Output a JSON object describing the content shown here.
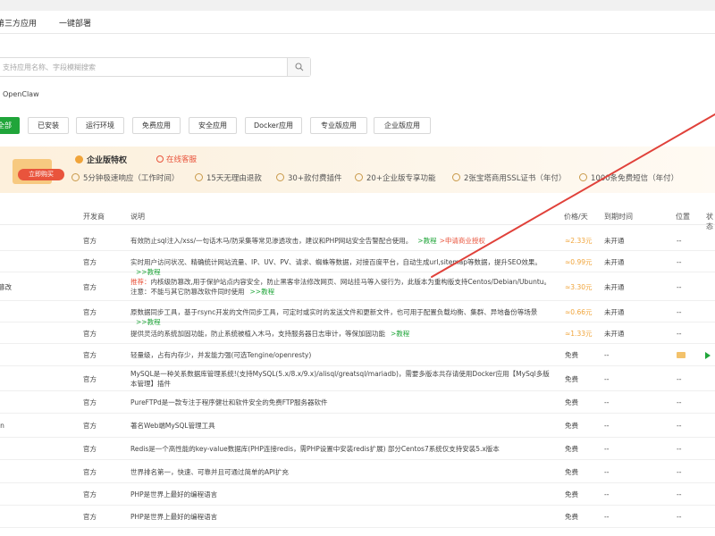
{
  "tabs": [
    "第三方应用",
    "一键部署"
  ],
  "search": {
    "placeholder": "支持应用名称、字段模糊搜索"
  },
  "recent": "OpenClaw",
  "categories": [
    "全部",
    "已安装",
    "运行环境",
    "免费应用",
    "安全应用",
    "Docker应用",
    "专业版应用",
    "企业版应用"
  ],
  "banner": {
    "badge": "立即购买",
    "title": "企业版特权",
    "service": "在线客服",
    "perks": [
      "5分钟极速响应（工作时间）",
      "15天无理由退款",
      "30+款付费插件",
      "20+企业版专享功能",
      "2张宝塔商用SSL证书（年付）",
      "1000条免费短信（年付）"
    ]
  },
  "table": {
    "headers": [
      "开发商",
      "说明",
      "价格/天",
      "到期时间",
      "位置",
      "状态"
    ],
    "rows": [
      {
        "name": "",
        "dev": "官方",
        "desc": "有效防止sql注入/xss/一句话木马/防采集等常见渗透攻击，建议和PHP网站安全告警配合使用。",
        "link1": ">教程",
        "link2": ">申请商业授权",
        "price": "≈2.33元",
        "expire": "未开通",
        "pos": "--",
        "status": ""
      },
      {
        "name": "",
        "dev": "官方",
        "desc": "实时用户访问状况、精确统计网站流量、IP、UV、PV、请求、蜘蛛等数据，对接百度平台，自动生成url,sitemap等数据，提升SEO效果。",
        "link1": ">>教程",
        "link2": "",
        "price": "≈0.99元",
        "expire": "未开通",
        "pos": "--",
        "status": ""
      },
      {
        "name": "篡改",
        "dev": "官方",
        "warn": "推荐：",
        "desc": "内核级防篡改,用于保护站点内容安全，防止黑客非法修改网页、网站挂马等入侵行为，此版本为重构版支持Centos/Debian/Ubuntu。注意：不能与其它防篡改软件同时使用",
        "link1": ">>教程",
        "link2": "",
        "price": "≈3.30元",
        "expire": "未开通",
        "pos": "--",
        "status": ""
      },
      {
        "name": "",
        "dev": "官方",
        "desc": "原数据同步工具，基于rsync开发的文件同步工具，可定时或实时的发送文件和更新文件，也可用于配置负载均衡、集群、异地备份等场景",
        "link1": ">>教程",
        "link2": "",
        "price": "≈0.66元",
        "expire": "未开通",
        "pos": "--",
        "status": ""
      },
      {
        "name": "",
        "dev": "官方",
        "desc": "提供灵活的系统加固功能，防止系统被植入木马，支持服务器日志审计，等保加固功能",
        "link1": ">教程",
        "link2": "",
        "price": "≈1.33元",
        "expire": "未开通",
        "pos": "--",
        "status": ""
      },
      {
        "name": "",
        "dev": "官方",
        "desc": "轻量级，占有内存少，并发能力强(可选Tengine/openresty)",
        "link1": "",
        "link2": "",
        "price": "免费",
        "expire": "--",
        "pos": "folder",
        "status": "play"
      },
      {
        "name": "",
        "dev": "官方",
        "desc": "MySQL是一种关系数据库管理系统!(支持MySQL(5.x/8.x/9.x)/alisql/greatsql/mariadb)，需要多版本共存请使用Docker应用【MySql多版本管理】插件",
        "link1": "",
        "link2": "",
        "price": "免费",
        "expire": "--",
        "pos": "--",
        "status": ""
      },
      {
        "name": "",
        "dev": "官方",
        "desc": "PureFTPd是一款专注于程序健壮和软件安全的免费FTP服务器软件",
        "link1": "",
        "link2": "",
        "price": "免费",
        "expire": "--",
        "pos": "--",
        "status": ""
      },
      {
        "name": "in",
        "dev": "官方",
        "desc": "著名Web端MySQL管理工具",
        "link1": "",
        "link2": "",
        "price": "免费",
        "expire": "--",
        "pos": "--",
        "status": ""
      },
      {
        "name": "",
        "dev": "官方",
        "desc": "Redis是一个高性能的key-value数据库(PHP连接redis，需PHP设置中安装redis扩展) 部分Centos7系统仅支持安装5.x版本",
        "link1": "",
        "link2": "",
        "price": "免费",
        "expire": "--",
        "pos": "--",
        "status": ""
      },
      {
        "name": "",
        "dev": "官方",
        "desc": "世界排名第一，快速、可靠并且可通过简单的API扩充",
        "link1": "",
        "link2": "",
        "price": "免费",
        "expire": "--",
        "pos": "--",
        "status": ""
      },
      {
        "name": "",
        "dev": "官方",
        "desc": "PHP是世界上最好的编程语言",
        "link1": "",
        "link2": "",
        "price": "免费",
        "expire": "--",
        "pos": "--",
        "status": ""
      },
      {
        "name": "",
        "dev": "官方",
        "desc": "PHP是世界上最好的编程语言",
        "link1": "",
        "link2": "",
        "price": "免费",
        "expire": "--",
        "pos": "--",
        "status": ""
      }
    ]
  },
  "colors": {
    "accent": "#20a53a",
    "warn": "#e9543c",
    "price": "#f0a43a",
    "annotation": "#e0413a"
  }
}
